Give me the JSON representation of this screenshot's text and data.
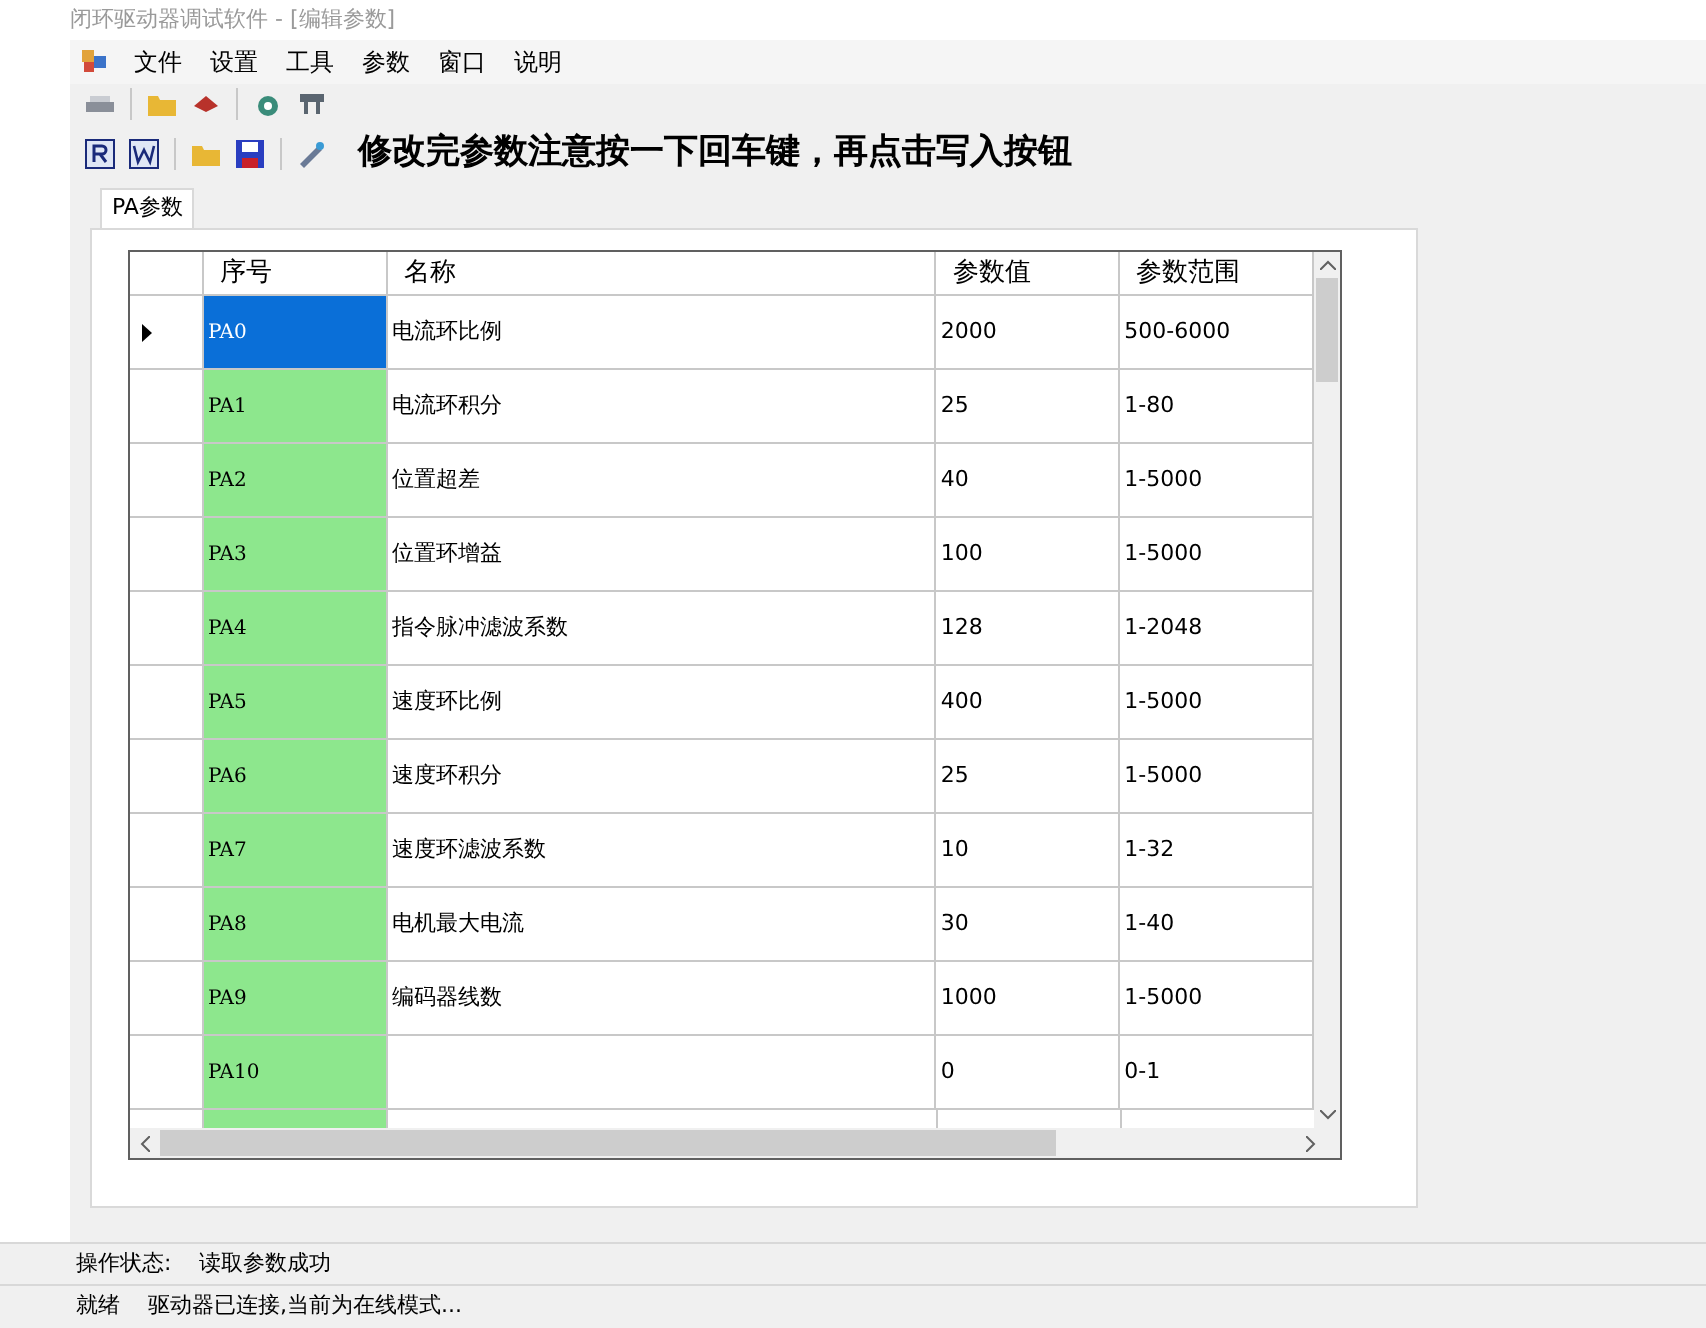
{
  "window": {
    "title": "闭环驱动器调试软件 - [编辑参数]"
  },
  "menu": [
    "文件",
    "设置",
    "工具",
    "参数",
    "窗口",
    "说明"
  ],
  "notice": "修改完参数注意按一下回车键，再点击写入按钮",
  "tabs": [
    {
      "label": "PA参数",
      "selected": true
    }
  ],
  "table": {
    "columns": [
      "序号",
      "名称",
      "参数值",
      "参数范围"
    ],
    "rows": [
      {
        "cells": [
          "PA0",
          "电流环比例",
          "2000",
          "500-6000"
        ],
        "selected": true,
        "current": true
      },
      {
        "cells": [
          "PA1",
          "电流环积分",
          "25",
          "1-80"
        ],
        "selected": false,
        "current": false
      },
      {
        "cells": [
          "PA2",
          "位置超差",
          "40",
          "1-5000"
        ],
        "selected": false,
        "current": false
      },
      {
        "cells": [
          "PA3",
          "位置环增益",
          "100",
          "1-5000"
        ],
        "selected": false,
        "current": false
      },
      {
        "cells": [
          "PA4",
          "指令脉冲滤波系数",
          "128",
          "1-2048"
        ],
        "selected": false,
        "current": false
      },
      {
        "cells": [
          "PA5",
          "速度环比例",
          "400",
          "1-5000"
        ],
        "selected": false,
        "current": false
      },
      {
        "cells": [
          "PA6",
          "速度环积分",
          "25",
          "1-5000"
        ],
        "selected": false,
        "current": false
      },
      {
        "cells": [
          "PA7",
          "速度环滤波系数",
          "10",
          "1-32"
        ],
        "selected": false,
        "current": false
      },
      {
        "cells": [
          "PA8",
          "电机最大电流",
          "30",
          "1-40"
        ],
        "selected": false,
        "current": false
      },
      {
        "cells": [
          "PA9",
          "编码器线数",
          "1000",
          "1-5000"
        ],
        "selected": false,
        "current": false
      },
      {
        "cells": [
          "PA10",
          "",
          "0",
          "0-1"
        ],
        "selected": false,
        "current": false
      }
    ]
  },
  "status": {
    "label": "操作状态:",
    "value": "读取参数成功"
  },
  "status_bar": {
    "state": "就绪",
    "message": "驱动器已连接,当前为在线模式..."
  }
}
